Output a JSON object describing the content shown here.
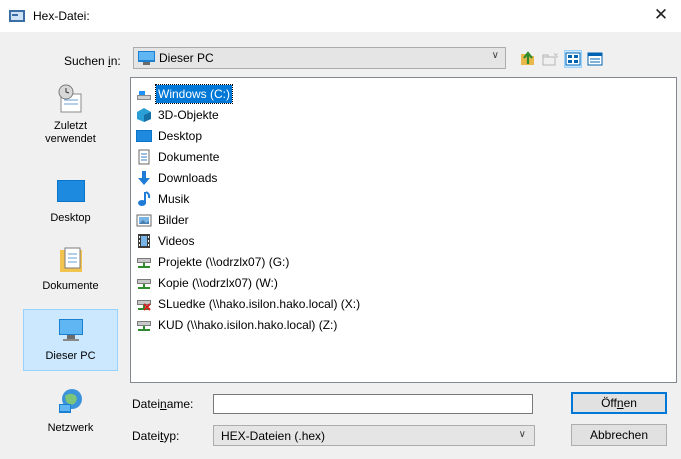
{
  "window": {
    "title": "Hex-Datei:",
    "close_glyph": "✕"
  },
  "lookin": {
    "label_pre": "Suchen ",
    "label_key": "i",
    "label_post": "n:",
    "value": "Dieser PC",
    "icon": "computer-icon"
  },
  "toolbar": {
    "items": [
      {
        "name": "up-folder-icon"
      },
      {
        "name": "new-folder-icon"
      },
      {
        "name": "view-tiles-icon",
        "selected": true
      },
      {
        "name": "view-details-icon"
      }
    ]
  },
  "places": [
    {
      "label1": "Zuletzt",
      "label2": "verwendet",
      "icon": "recent-icon"
    },
    {
      "label1": "Desktop",
      "icon": "desktop-icon"
    },
    {
      "label1": "Dokumente",
      "icon": "documents-icon"
    },
    {
      "label1": "Dieser PC",
      "icon": "computer-icon",
      "selected": true
    },
    {
      "label1": "Netzwerk",
      "icon": "network-icon"
    }
  ],
  "files": [
    {
      "label": "Windows (C:)",
      "icon": "drive-icon",
      "selected": true
    },
    {
      "label": "3D-Objekte",
      "icon": "3d-objects-icon"
    },
    {
      "label": "Desktop",
      "icon": "desktop-folder-icon"
    },
    {
      "label": "Dokumente",
      "icon": "documents-folder-icon"
    },
    {
      "label": "Downloads",
      "icon": "downloads-icon"
    },
    {
      "label": "Musik",
      "icon": "music-icon"
    },
    {
      "label": "Bilder",
      "icon": "pictures-icon"
    },
    {
      "label": "Videos",
      "icon": "videos-icon"
    },
    {
      "label": "Projekte (\\\\odrzlx07) (G:)",
      "icon": "network-drive-icon"
    },
    {
      "label": "Kopie (\\\\odrzlx07) (W:)",
      "icon": "network-drive-icon"
    },
    {
      "label": "SLuedke (\\\\hako.isilon.hako.local) (X:)",
      "icon": "disconnected-network-drive-icon"
    },
    {
      "label": "KUD (\\\\hako.isilon.hako.local) (Z:)",
      "icon": "network-drive-icon"
    }
  ],
  "filename": {
    "label_pre": "Datei",
    "label_key": "n",
    "label_post": "ame:",
    "value": ""
  },
  "filetype": {
    "label_pre": "Datei",
    "label_key": "t",
    "label_post": "yp:",
    "value": "HEX-Dateien (.hex)"
  },
  "buttons": {
    "open_pre": "Öff",
    "open_key": "n",
    "open_post": "en",
    "cancel": "Abbrechen"
  }
}
